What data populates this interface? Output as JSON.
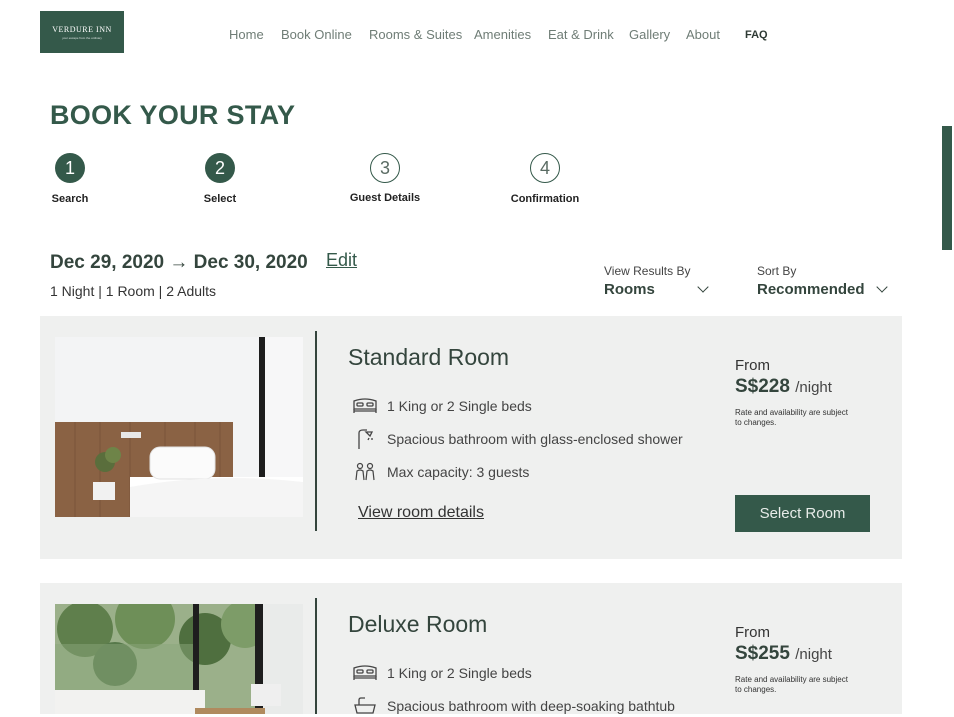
{
  "brand": {
    "name": "VERDURE INN",
    "tagline": "your escape from the ordinary"
  },
  "nav": [
    "Home",
    "Book Online",
    "Rooms & Suites",
    "Amenities",
    "Eat & Drink",
    "Gallery",
    "About",
    "FAQ"
  ],
  "page_title": "BOOK YOUR STAY",
  "steps": [
    {
      "number": "1",
      "label": "Search",
      "state": "done"
    },
    {
      "number": "2",
      "label": "Select",
      "state": "current"
    },
    {
      "number": "3",
      "label": "Guest Details",
      "state": "todo"
    },
    {
      "number": "4",
      "label": "Confirmation",
      "state": "todo"
    }
  ],
  "booking": {
    "dates": "Dec 29, 2020 → Dec 30, 2020",
    "edit": "Edit",
    "summary": "1 Night | 1 Room | 2 Adults"
  },
  "controls": {
    "view_label": "View Results By",
    "view_value": "Rooms",
    "sort_label": "Sort By",
    "sort_value": "Recommended"
  },
  "rooms": [
    {
      "name": "Standard Room",
      "features": [
        {
          "icon": "bed-icon",
          "text": "1 King or 2 Single beds"
        },
        {
          "icon": "shower-icon",
          "text": "Spacious bathroom with glass-enclosed shower"
        },
        {
          "icon": "guests-icon",
          "text": "Max capacity: 3 guests"
        }
      ],
      "details_link": "View room details",
      "from": "From",
      "price": "S$228",
      "per": "/night",
      "note": "Rate and availability are subject to changes.",
      "cta": "Select Room"
    },
    {
      "name": "Deluxe Room",
      "features": [
        {
          "icon": "bed-icon",
          "text": "1 King or 2 Single beds"
        },
        {
          "icon": "bathtub-icon",
          "text": "Spacious bathroom with deep-soaking bathtub"
        }
      ],
      "from": "From",
      "price": "S$255",
      "per": "/night",
      "note": "Rate and availability are subject to changes."
    }
  ],
  "colors": {
    "accent": "#34594a",
    "card_bg": "#eff0ef",
    "text_dark": "#34453d"
  }
}
